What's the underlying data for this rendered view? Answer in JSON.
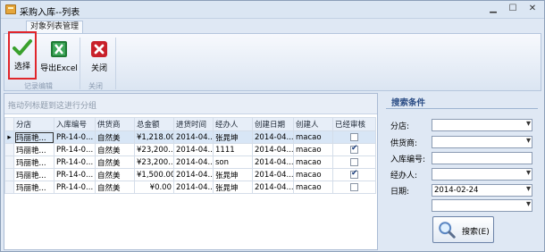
{
  "window": {
    "title": "采购入库--列表",
    "min": "▁",
    "max": "☐",
    "close": "✕"
  },
  "ribbon": {
    "tab": "对象列表管理",
    "buttons": {
      "select": "选择",
      "export": "导出Excel",
      "close": "关闭"
    },
    "groups": {
      "edit": "记录编辑",
      "close": "关闭"
    }
  },
  "grid": {
    "group_hint": "拖动列标题到这进行分组",
    "columns": [
      "分店",
      "入库编号",
      "供货商",
      "总金额",
      "进货时间",
      "经办人",
      "创建日期",
      "创建人",
      "已经审核"
    ],
    "rows": [
      {
        "store": "玛丽艳...",
        "no": "PR-14-0...",
        "supplier": "自然美",
        "amount": "¥1,218.00",
        "time": "2014-04...",
        "handler": "张晁坤",
        "created": "2014-04...",
        "creator": "macao",
        "checked": false
      },
      {
        "store": "玛丽艳...",
        "no": "PR-14-0...",
        "supplier": "自然美",
        "amount": "¥23,200...",
        "time": "2014-04...",
        "handler": "1111",
        "created": "2014-04...",
        "creator": "macao",
        "checked": true
      },
      {
        "store": "玛丽艳...",
        "no": "PR-14-0...",
        "supplier": "自然美",
        "amount": "¥23,200...",
        "time": "2014-04...",
        "handler": "son",
        "created": "2014-04...",
        "creator": "macao",
        "checked": false
      },
      {
        "store": "玛丽艳...",
        "no": "PR-14-0...",
        "supplier": "自然美",
        "amount": "¥1,500.00",
        "time": "2014-04...",
        "handler": "张晁坤",
        "created": "2014-04...",
        "creator": "macao",
        "checked": true
      },
      {
        "store": "玛丽艳...",
        "no": "PR-14-0...",
        "supplier": "自然美",
        "amount": "¥0.00",
        "time": "2014-04...",
        "handler": "张晁坤",
        "created": "2014-04...",
        "creator": "macao",
        "checked": false
      }
    ]
  },
  "search": {
    "title": "搜索条件",
    "fields": {
      "store": {
        "label": "分店:",
        "value": ""
      },
      "supplier": {
        "label": "供货商:",
        "value": ""
      },
      "number": {
        "label": "入库编号:",
        "value": ""
      },
      "handler": {
        "label": "经办人:",
        "value": ""
      },
      "date": {
        "label": "日期:",
        "value": "2014-02-24"
      },
      "extra": {
        "value": ""
      }
    },
    "button": "搜索(E)"
  },
  "colors": {
    "accent_red": "#e0262c",
    "check_green": "#3aa12d",
    "excel_green": "#1f7a34",
    "close_red": "#c8202a"
  },
  "icons": {
    "select": "checkmark-icon",
    "export": "excel-icon",
    "close": "close-x-icon",
    "search": "magnifier-icon"
  }
}
